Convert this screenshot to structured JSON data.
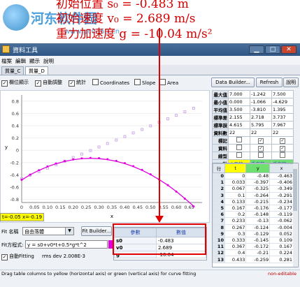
{
  "overlay": {
    "line1": "初始位置 s₀ = -0.483 m",
    "line2": "初始速度 v₀ = 2.689 m/s",
    "line3": "重力加速度 g = -10.04 m/s²",
    "watermark_text": "河东软件园",
    "watermark_url": "www.pc0359.cn"
  },
  "window": {
    "title": "資料工具",
    "min_label": "▁",
    "max_label": "□",
    "close_label": "✕"
  },
  "menu": [
    "檔案",
    "編輯",
    "顯示",
    "說明"
  ],
  "tabs": [
    "質量_C",
    "質量_D"
  ],
  "toolbar": {
    "checkboxes": [
      {
        "label": "欄位顯示",
        "checked": true
      },
      {
        "label": "自動調整",
        "checked": true
      },
      {
        "label": "統計",
        "checked": true
      },
      {
        "label": "Coordinates",
        "checked": false
      },
      {
        "label": "Slope",
        "checked": false
      },
      {
        "label": "Area",
        "checked": false
      }
    ],
    "data_builder": "Data Builder...",
    "refresh": "Refresh",
    "help": "說明"
  },
  "chart_data": {
    "type": "scatter",
    "xlabel": "x",
    "ylabel": "y",
    "xlim": [
      0,
      0.7
    ],
    "ylim": [
      -0.85,
      0.9
    ],
    "xticks": [
      "0",
      "0.05",
      "0.10",
      "0.15",
      "0.20",
      "0.25",
      "0.30",
      "0.35",
      "0.40",
      "0.45",
      "0.50",
      "0.55",
      "0.60",
      "0.65"
    ],
    "yticks": [
      "0.8",
      "0.6",
      "0.4",
      "0.2",
      "0",
      "-0.2",
      "-0.4",
      "-0.6",
      "-0.8"
    ],
    "series": [
      {
        "color": "#c8a3e6",
        "marker": "square",
        "x": [
          0.0,
          0.033,
          0.067,
          0.1,
          0.133,
          0.167,
          0.2,
          0.233,
          0.267,
          0.3,
          0.333,
          0.367,
          0.4,
          0.433,
          0.467,
          0.5,
          0.533,
          0.567,
          0.6,
          0.633,
          0.667
        ],
        "values": [
          -0.463,
          -0.406,
          -0.349,
          -0.291,
          -0.234,
          -0.177,
          -0.119,
          -0.062,
          -0.005,
          0.053,
          0.11,
          0.167,
          0.224,
          0.282,
          0.339,
          0.396,
          0.454,
          0.511,
          0.568,
          0.626,
          0.683
        ]
      },
      {
        "color": "#e000e0",
        "marker": "circle",
        "x": [
          0.0,
          0.033,
          0.067,
          0.1,
          0.133,
          0.167,
          0.2,
          0.233,
          0.267,
          0.3,
          0.333,
          0.367,
          0.4,
          0.433,
          0.467,
          0.5,
          0.533,
          0.567,
          0.6,
          0.633,
          0.667
        ],
        "values": [
          -0.48,
          -0.397,
          -0.325,
          -0.264,
          -0.215,
          -0.176,
          -0.148,
          -0.131,
          -0.124,
          -0.129,
          -0.145,
          -0.172,
          -0.21,
          -0.259,
          -0.319,
          -0.391,
          -0.474,
          -0.567,
          -0.672,
          -0.788,
          -0.914
        ]
      },
      {
        "color": "#e000e0",
        "marker": "line",
        "fit": true,
        "x": [
          0.0,
          0.033,
          0.067,
          0.1,
          0.133,
          0.167,
          0.2,
          0.233,
          0.267,
          0.3,
          0.333,
          0.367,
          0.4,
          0.433,
          0.467,
          0.5,
          0.533,
          0.567,
          0.6,
          0.633,
          0.667
        ],
        "values": [
          -0.483,
          -0.398,
          -0.327,
          -0.267,
          -0.219,
          -0.181,
          -0.154,
          -0.137,
          -0.131,
          -0.136,
          -0.152,
          -0.179,
          -0.217,
          -0.265,
          -0.325,
          -0.395,
          -0.476,
          -0.568,
          -0.671,
          -0.784,
          -0.908
        ]
      }
    ]
  },
  "coord_readout": "t=-0.05  x=-0.19",
  "fit": {
    "name_label": "Fit 名稱",
    "name_value": "自由落體",
    "builder": "Fit Builder...",
    "eq_label": "Fit方程式:",
    "equation": "y = s0+v0*t+0.5*g*t^2",
    "autofit_label": "自動Fitting",
    "rms": "rms dev 2.008E-3",
    "params_header": [
      "參數",
      "數值"
    ],
    "params": [
      {
        "name": "s0",
        "value": "-0.483"
      },
      {
        "name": "v0",
        "value": "2.689"
      },
      {
        "name": "g",
        "value": "-10.04"
      }
    ]
  },
  "stats": {
    "rows": [
      {
        "label": "最大值",
        "vals": [
          "7.000",
          "-1.242",
          "7.500"
        ]
      },
      {
        "label": "最小值",
        "vals": [
          "0.000",
          "-1.066",
          "-4.629"
        ]
      },
      {
        "label": "平均值",
        "vals": [
          "3.500",
          "-3.810",
          "1.395"
        ]
      },
      {
        "label": "標準差",
        "vals": [
          "2.155",
          "2.718",
          "3.737"
        ]
      },
      {
        "label": "標準誤",
        "vals": [
          "4.615",
          "5.795",
          "7.967"
        ]
      },
      {
        "label": "資料數",
        "vals": [
          "22",
          "22",
          "22"
        ]
      }
    ],
    "flags": [
      {
        "label": "標記"
      },
      {
        "label": "資料"
      },
      {
        "label": "線型"
      }
    ],
    "axis_label": "軸",
    "axis_vals": [
      "水平的",
      "垂直的",
      "垂直的"
    ]
  },
  "data_table": {
    "headers": [
      "行",
      "t",
      "y",
      "x"
    ],
    "rows": [
      [
        "0",
        "0",
        "-0.48",
        "-0.463"
      ],
      [
        "1",
        "0.033",
        "-0.397",
        "-0.406"
      ],
      [
        "2",
        "0.067",
        "-0.325",
        "-0.349"
      ],
      [
        "3",
        "0.1",
        "-0.264",
        "-0.291"
      ],
      [
        "4",
        "0.133",
        "-0.215",
        "-0.234"
      ],
      [
        "5",
        "0.167",
        "-0.176",
        "-0.177"
      ],
      [
        "6",
        "0.2",
        "-0.148",
        "-0.119"
      ],
      [
        "7",
        "0.233",
        "-0.13",
        "-0.062"
      ],
      [
        "8",
        "0.267",
        "-0.124",
        "-0.004"
      ],
      [
        "9",
        "0.3",
        "-0.129",
        "0.052"
      ],
      [
        "10",
        "0.333",
        "-0.145",
        "0.109"
      ],
      [
        "11",
        "0.367",
        "-0.172",
        "0.167"
      ],
      [
        "12",
        "0.4",
        "-0.21",
        "0.224"
      ],
      [
        "13",
        "0.433",
        "-0.259",
        "0.281"
      ]
    ]
  },
  "status": {
    "hint": "Drag table columns to yellow (horizontal axis) or green (vertical axis) for curve fitting",
    "editable": "non-editable"
  }
}
